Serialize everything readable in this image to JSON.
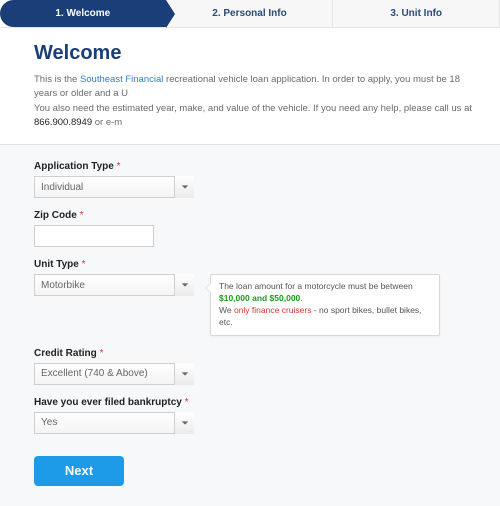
{
  "steps": [
    {
      "label": "1. Welcome"
    },
    {
      "label": "2. Personal Info"
    },
    {
      "label": "3. Unit Info"
    }
  ],
  "heading": "Welcome",
  "intro": {
    "prefix": "This is the ",
    "brand": "Southeast Financial",
    "line1_rest": " recreational vehicle loan application. In order to apply, you must be 18 years or older and a U",
    "line2_prefix": "You also need the estimated year, make, and value of the vehicle. If you need any help,  please call us at ",
    "phone": "866.900.8949",
    "line2_rest": " or e-m"
  },
  "form": {
    "app_type": {
      "label": "Application Type",
      "value": "Individual"
    },
    "zip": {
      "label": "Zip Code",
      "value": ""
    },
    "unit_type": {
      "label": "Unit Type",
      "value": "Motorbike"
    },
    "credit": {
      "label": "Credit Rating",
      "value": "Excellent (740 & Above)"
    },
    "bankruptcy": {
      "label": "Have you ever filed bankruptcy",
      "value": "Yes"
    }
  },
  "hint": {
    "part1": "The loan amount for a motorcycle must be between ",
    "range": "$10,000 and $50,000",
    "part2": ".",
    "part3": "We ",
    "only_finance": "only finance cruisers",
    "part4": " - no sport bikes, bullet bikes, etc."
  },
  "next_label": "Next",
  "required_mark": "*"
}
